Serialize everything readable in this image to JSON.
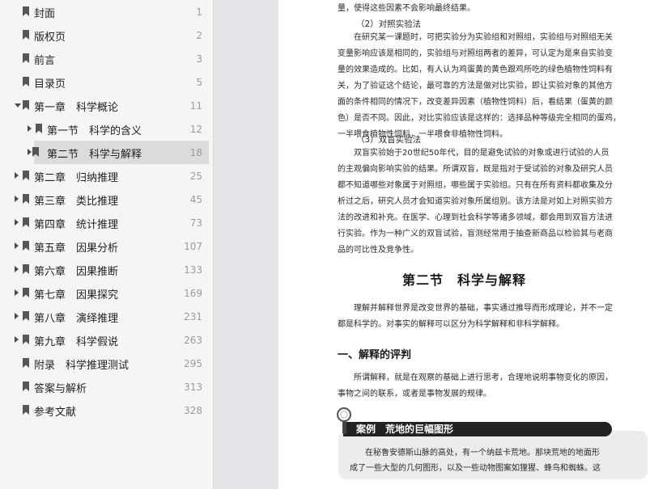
{
  "toc": {
    "items": [
      {
        "label": "封面",
        "page": "1",
        "level": 0,
        "arrow": "none"
      },
      {
        "label": "版权页",
        "page": "2",
        "level": 0,
        "arrow": "none"
      },
      {
        "label": "前言",
        "page": "3",
        "level": 0,
        "arrow": "none"
      },
      {
        "label": "目录页",
        "page": "5",
        "level": 0,
        "arrow": "none"
      },
      {
        "label": "第一章　科学概论",
        "page": "11",
        "level": 0,
        "arrow": "down"
      },
      {
        "label": "第一节　科学的含义",
        "page": "12",
        "level": 1,
        "arrow": "right"
      },
      {
        "label": "第二节　科学与解释",
        "page": "18",
        "level": 1,
        "arrow": "right",
        "selected": true
      },
      {
        "label": "第二章　归纳推理",
        "page": "25",
        "level": 0,
        "arrow": "right"
      },
      {
        "label": "第三章　类比推理",
        "page": "45",
        "level": 0,
        "arrow": "right"
      },
      {
        "label": "第四章　统计推理",
        "page": "73",
        "level": 0,
        "arrow": "right"
      },
      {
        "label": "第五章　因果分析",
        "page": "107",
        "level": 0,
        "arrow": "right"
      },
      {
        "label": "第六章　因果推断",
        "page": "133",
        "level": 0,
        "arrow": "right"
      },
      {
        "label": "第七章　因果探究",
        "page": "169",
        "level": 0,
        "arrow": "right"
      },
      {
        "label": "第八章　演绎推理",
        "page": "231",
        "level": 0,
        "arrow": "right"
      },
      {
        "label": "第九章　科学假说",
        "page": "263",
        "level": 0,
        "arrow": "right"
      },
      {
        "label": "附录　科学推理测试",
        "page": "295",
        "level": 0,
        "arrow": "none"
      },
      {
        "label": "答案与解析",
        "page": "313",
        "level": 0,
        "arrow": "none"
      },
      {
        "label": "参考文献",
        "page": "328",
        "level": 0,
        "arrow": "none"
      }
    ]
  },
  "doc": {
    "lines": [
      "量，使得这些因素不会影响最终结果。",
      "（2）对照实验法",
      "在研究某一课题时，可把实验分为实验组和对照组，实验组与对照组无关",
      "变量影响应该是相同的，实验组与对照组两者的差异，可认定为是来自实验变",
      "量的效果造成的。比如，有人认为鸡蛋黄的黄色跟鸡所吃的绿色植物性饲料有",
      "关，为了验证这个结论，最可靠的方法是做对比实验，即让实验对象的其他方",
      "面的条件相同的情况下，改变差异因素（植物性饲料）后，看结果（蛋黄的颜",
      "色）是否不同。因此，对比实验应该是这样的：选择品种等级完全相同的蛋鸡，",
      "一半喂食植物性饲料，一半喂食非植物性饲料。",
      "（3）双盲实验法",
      "双盲实验始于20世纪50年代，目的是避免试验的对象或进行试验的人员",
      "的主观偏向影响实验的结果。所谓双盲，既是指对于受试验的对象及研究人员",
      "都不知道哪些对象属于对照组，哪些属于实验组。只有在所有资料都收集及分",
      "析过之后，研究人员才会知道实验对象所属组别。该方法是对如上对照实验方",
      "法的改进和补充。在医学、心理到社会科学等诸多领域，都会用到双盲方法进",
      "行实验。作为一种广义的双盲试验，盲测经常用于抽查新商品以检验其与老商",
      "品的可比性及竞争性。"
    ],
    "section_title": "第二节　科学与解释",
    "intro_1": "理解并解释世界是改变世界的基础，事实通过推导而形成理论，并不一定",
    "intro_2": "都是科学的。对事实的解释可以区分为科学解释和非科学解释。",
    "heading_1": "一、解释的评判",
    "def_1": "所谓解释，就是在观察的基础上进行思考，合理地说明事物变化的原因，",
    "def_2": "事物之间的联系，或者是事物发展的规律。",
    "case_title": "案例　荒地的巨幅图形",
    "case_1": "在秘鲁安德斯山脉的高处，有一个纳兹卡荒地。那块荒地的地面形",
    "case_2": "成了一些大型的几何图形，以及一些动物图案如狸猩、蜂鸟和蜘蛛。这"
  }
}
